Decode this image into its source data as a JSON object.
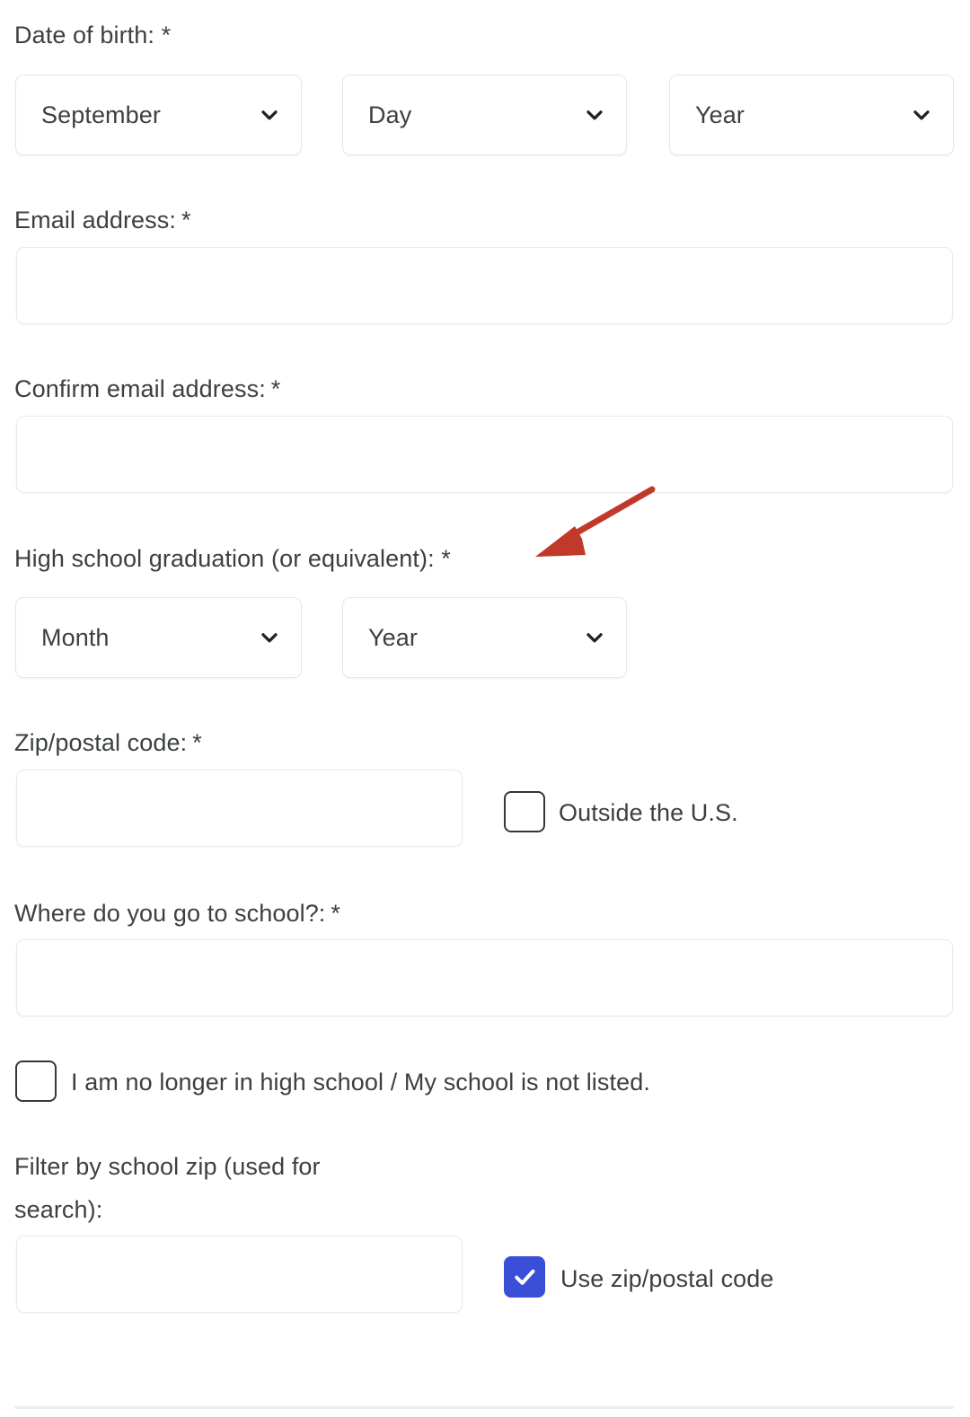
{
  "form": {
    "fields": [
      {
        "id": "date-of-birth",
        "label": "Date of birth: ",
        "required_mark": "*",
        "selects": [
          {
            "name": "dob-month",
            "value": "September"
          },
          {
            "name": "dob-day",
            "value": "Day"
          },
          {
            "name": "dob-year",
            "value": "Year"
          }
        ]
      },
      {
        "id": "email-address",
        "label": "Email address:",
        "required_mark": "*",
        "input": {
          "name": "email-input",
          "value": "",
          "placeholder": ""
        }
      },
      {
        "id": "confirm-email-address",
        "label": "Confirm email address:",
        "required_mark": "*",
        "input": {
          "name": "confirm-email-input",
          "value": "",
          "placeholder": ""
        }
      },
      {
        "id": "high-school-graduation",
        "label": "High school graduation (or equivalent): ",
        "required_mark": "*",
        "selects": [
          {
            "name": "grad-month",
            "value": "Month"
          },
          {
            "name": "grad-year",
            "value": "Year"
          }
        ]
      },
      {
        "id": "zip-postal-code",
        "label": "Zip/postal code:",
        "required_mark": "*",
        "input": {
          "name": "zip-input",
          "value": "",
          "placeholder": ""
        },
        "checkbox": {
          "name": "outside-us-checkbox",
          "label": "Outside the U.S.",
          "checked": false
        }
      },
      {
        "id": "where-do-you-go-to-school",
        "label": "Where do you go to school?:",
        "required_mark": "*",
        "input": {
          "name": "school-input",
          "value": "",
          "placeholder": ""
        },
        "checkbox": {
          "name": "no-longer-in-high-school-checkbox",
          "label": "I am no longer in high school / My school is not listed.",
          "checked": false
        }
      },
      {
        "id": "filter-by-school-zip",
        "label": "Filter by school zip (used for search):",
        "required_mark": "",
        "input": {
          "name": "school-zip-input",
          "value": "",
          "placeholder": ""
        },
        "checkbox": {
          "name": "use-zip-postal-code-checkbox",
          "label": "Use zip/postal code",
          "checked": true
        }
      }
    ]
  },
  "annotation": {
    "type": "arrow",
    "color": "#c0392b",
    "points_to": "high-school-graduation-required-mark"
  },
  "colors": {
    "checkbox_checked": "#3b4ed8",
    "label_text": "#3c4043",
    "field_border": "#e6e8ea",
    "annotation_red": "#c0392b",
    "divider": "#eceded",
    "background": "#ffffff"
  }
}
